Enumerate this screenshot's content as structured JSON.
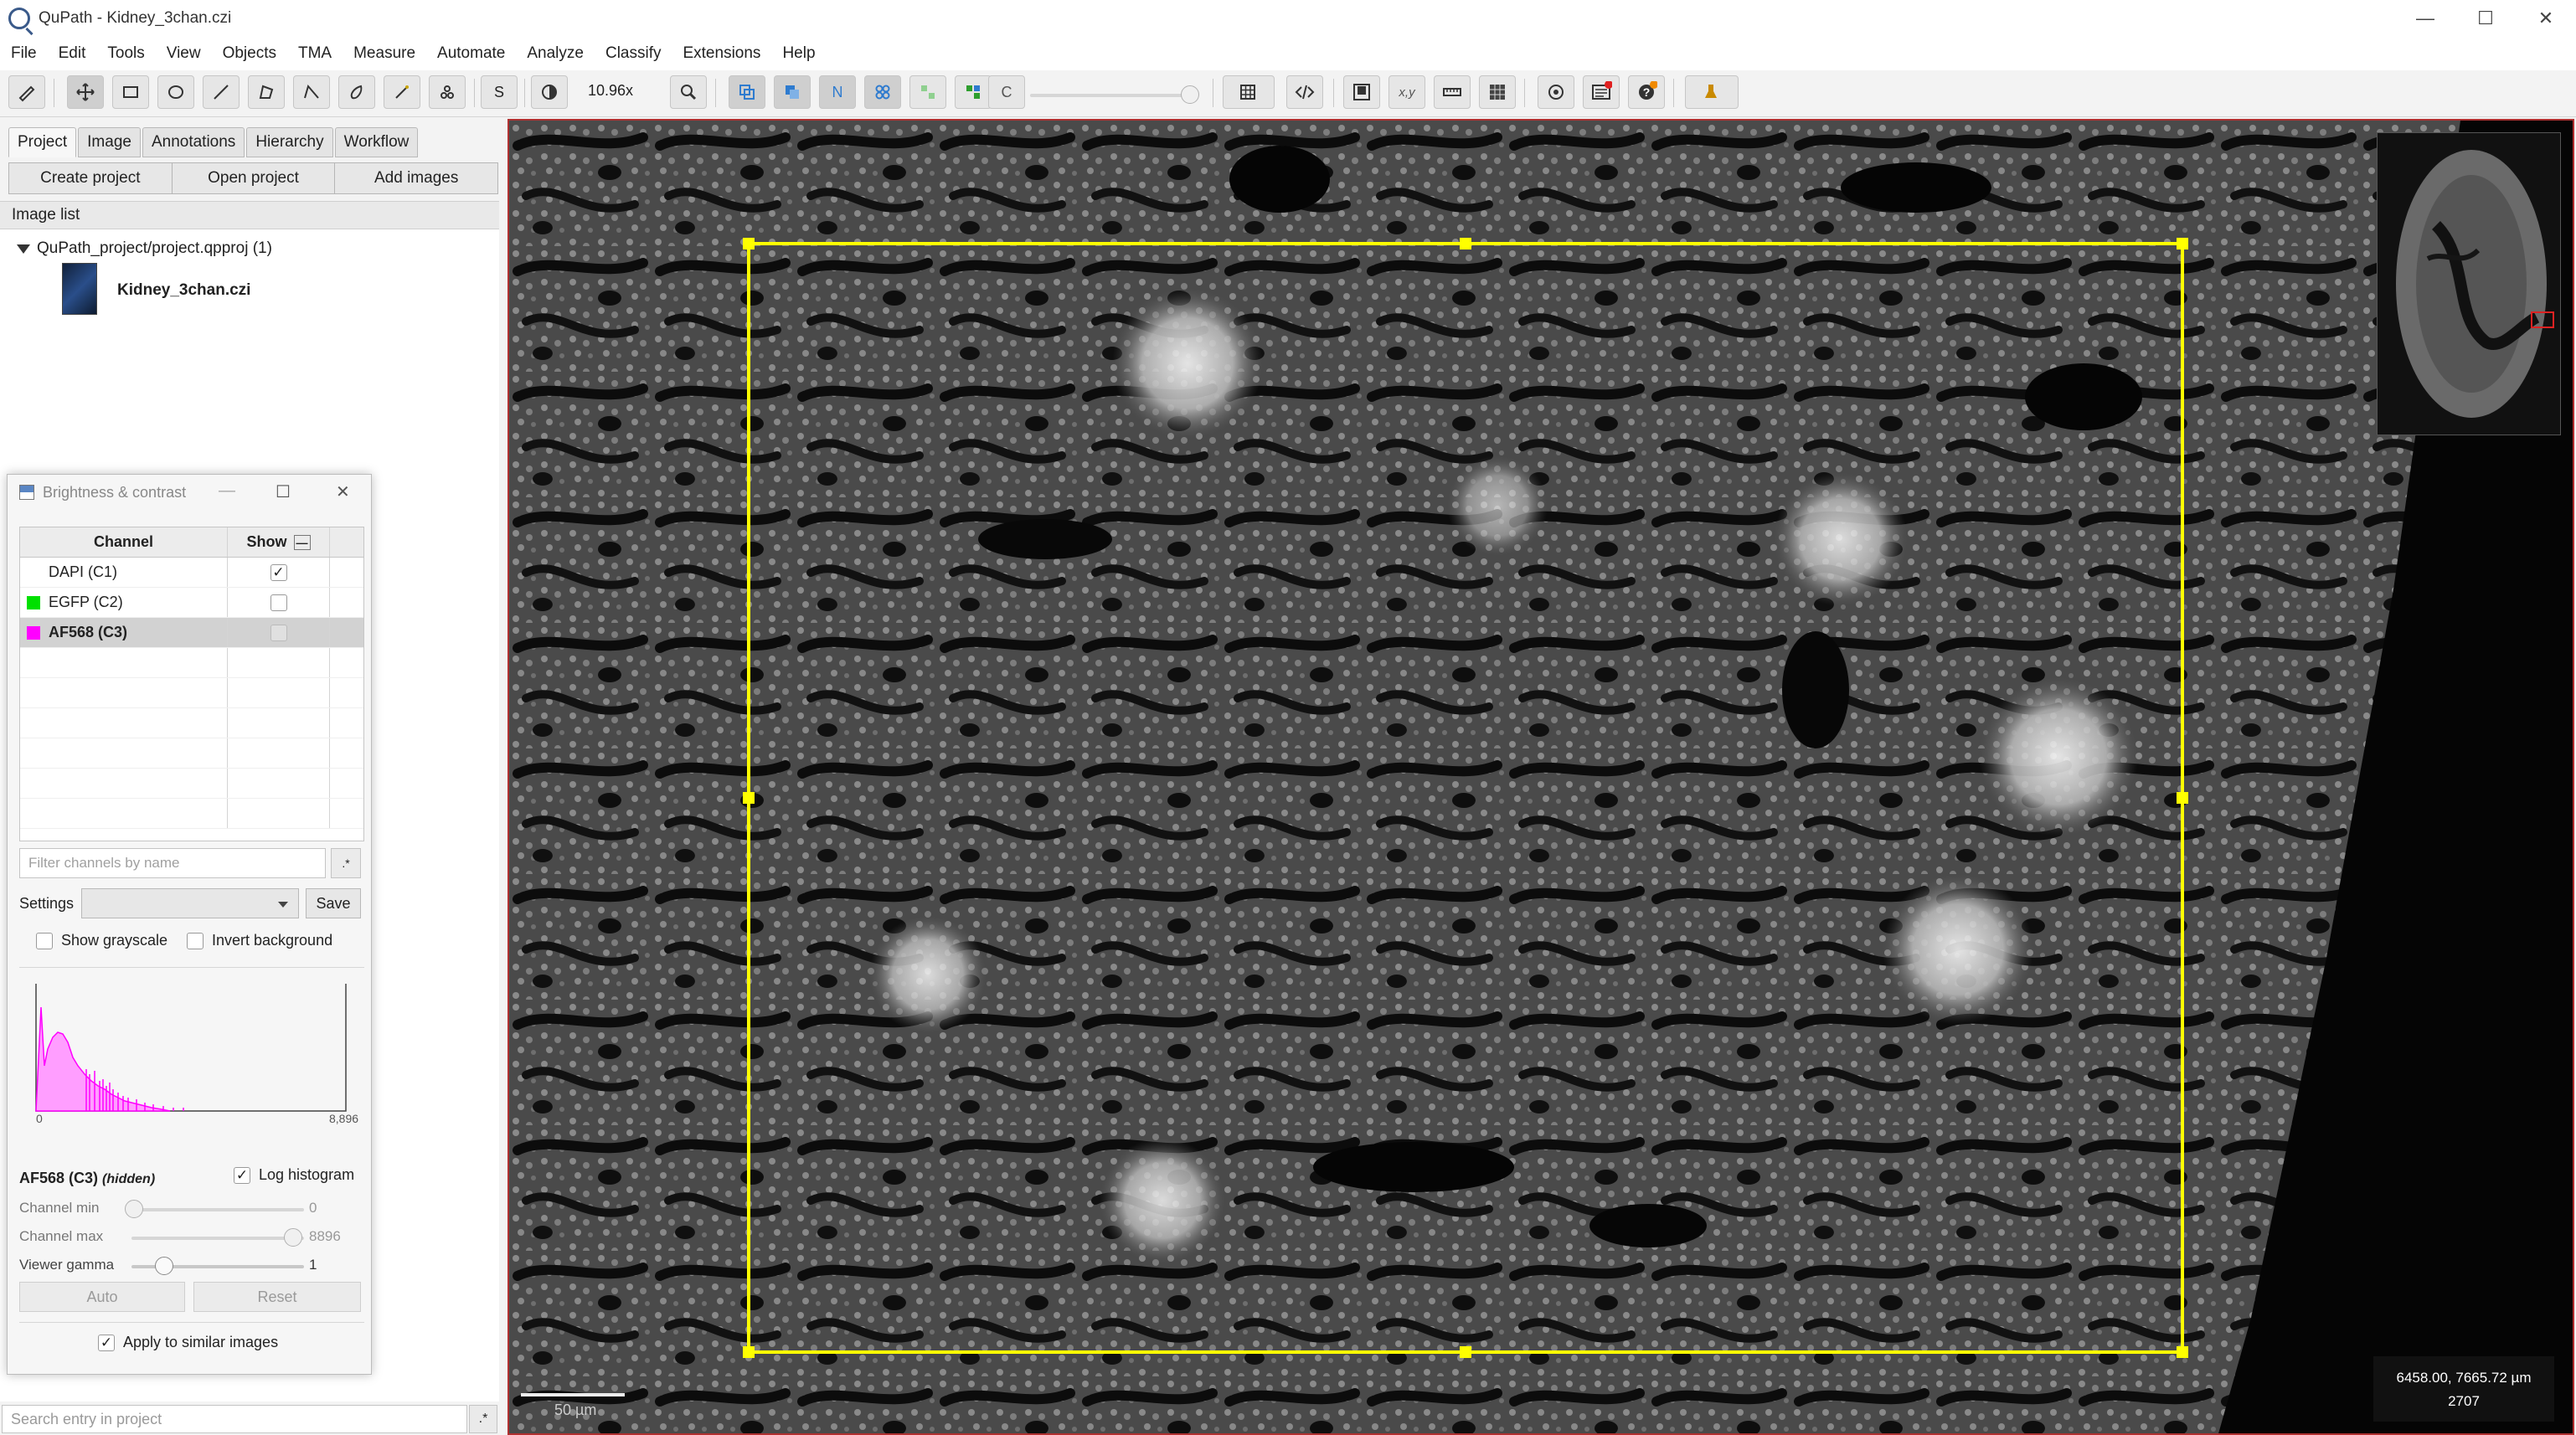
{
  "window": {
    "title": "QuPath - Kidney_3chan.czi",
    "controls": [
      "—",
      "☐",
      "✕"
    ]
  },
  "menu": [
    "File",
    "Edit",
    "Tools",
    "View",
    "Objects",
    "TMA",
    "Measure",
    "Automate",
    "Analyze",
    "Classify",
    "Extensions",
    "Help"
  ],
  "toolbar": {
    "zoom": "10.96x",
    "s_label": "S",
    "n_label": "N",
    "c_label": "C",
    "xy_label": "x,y"
  },
  "left_tabs": [
    "Project",
    "Image",
    "Annotations",
    "Hierarchy",
    "Workflow"
  ],
  "project_buttons": [
    "Create project",
    "Open project",
    "Add images"
  ],
  "image_list_header": "Image list",
  "project": {
    "name": "QuPath_project/project.qpproj (1)",
    "image": "Kidney_3chan.czi"
  },
  "search_placeholder": "Search entry in project",
  "bc": {
    "title": "Brightness & contrast",
    "col_channel": "Channel",
    "col_show": "Show",
    "channels": [
      {
        "name": "DAPI (C1)",
        "color": "#ffffff",
        "show": true
      },
      {
        "name": "EGFP (C2)",
        "color": "#00e000",
        "show": false
      },
      {
        "name": "AF568 (C3)",
        "color": "#ff00ff",
        "show": false
      }
    ],
    "filter_placeholder": "Filter channels by name",
    "filter_btn": ".*",
    "settings_label": "Settings",
    "save_label": "Save",
    "show_grayscale": "Show grayscale",
    "invert_background": "Invert background",
    "hist_min": "0",
    "hist_max": "8,896",
    "selected_channel": "AF568 (C3)",
    "hidden_tag": "(hidden)",
    "log_histogram": "Log histogram",
    "channel_min_label": "Channel min",
    "channel_min_value": "0",
    "channel_max_label": "Channel max",
    "channel_max_value": "8896",
    "gamma_label": "Viewer gamma",
    "gamma_value": "1",
    "auto_label": "Auto",
    "reset_label": "Reset",
    "apply_similar": "Apply to similar images"
  },
  "viewer": {
    "scalebar": "50 µm",
    "coords": "6458.00, 7665.72 µm",
    "value": "2707"
  },
  "colors": {
    "annotation": "#ffff00",
    "viewer_border": "#b03030"
  }
}
